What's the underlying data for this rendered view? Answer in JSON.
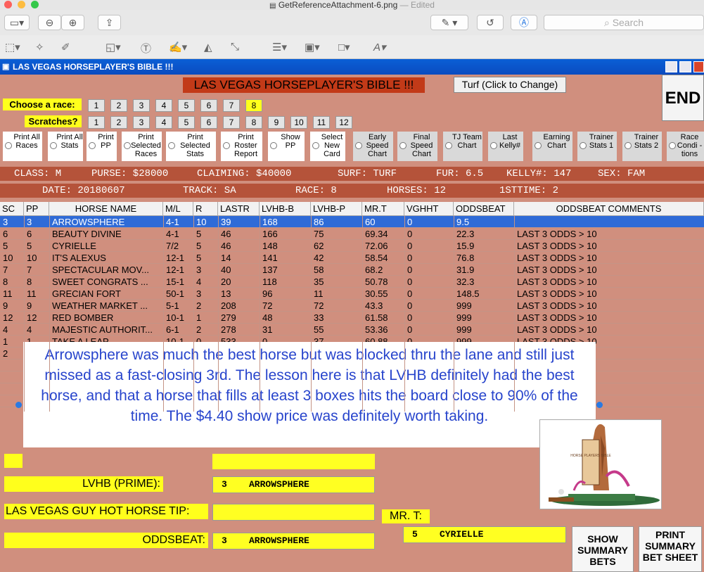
{
  "mac": {
    "title": "GetReferenceAttachment-6.png",
    "edited": "— Edited",
    "search_placeholder": "Search"
  },
  "app": {
    "window_title": "LAS VEGAS HORSEPLAYER'S BIBLE !!!",
    "banner": "LAS VEGAS HORSEPLAYER'S BIBLE !!!",
    "turf_button": "Turf (Click to Change)",
    "end_button": "END"
  },
  "race_select": {
    "choose_label": "Choose  a race:",
    "races": [
      "1",
      "2",
      "3",
      "4",
      "5",
      "6",
      "7",
      "8"
    ],
    "selected_race": "8",
    "scratches_label": "Scratches?",
    "scratches": [
      "1",
      "2",
      "3",
      "4",
      "5",
      "6",
      "7",
      "8",
      "9",
      "10",
      "11",
      "12"
    ]
  },
  "options": [
    {
      "label": "Print All Races"
    },
    {
      "label": "Print All Stats"
    },
    {
      "label": "Print PP"
    },
    {
      "label": "Print Selected Races"
    },
    {
      "label": "Print Selected Stats"
    },
    {
      "label": "Print Roster Report"
    },
    {
      "label": "Show PP"
    },
    {
      "label": "Select New Card"
    },
    {
      "label": "Early Speed Chart"
    },
    {
      "label": "Final Speed Chart"
    },
    {
      "label": "TJ Team Chart"
    },
    {
      "label": "Last Kelly#"
    },
    {
      "label": "Earning Chart"
    },
    {
      "label": "Trainer Stats 1"
    },
    {
      "label": "Trainer Stats 2"
    },
    {
      "label": "Race Condi -tions"
    }
  ],
  "info1": {
    "class": "CLASS: M",
    "purse": "PURSE: $28000",
    "claiming": "CLAIMING: $40000",
    "surf": "SURF: TURF",
    "fur": "FUR: 6.5",
    "kelly": "KELLY#: 147",
    "sex": "SEX: FAM"
  },
  "info2": {
    "date": "DATE: 20180607",
    "track": "TRACK: SA",
    "race": "RACE: 8",
    "horses": "HORSES: 12",
    "firsttime": "1STTIME:  2"
  },
  "table": {
    "columns": [
      "SC",
      "PP",
      "HORSE NAME",
      "M/L",
      "R",
      "LASTR",
      "LVHB-B",
      "LVHB-P",
      "MR.T",
      "VGHHT",
      "ODDSBEAT",
      "ODDSBEAT COMMENTS"
    ],
    "rows": [
      [
        "3",
        "3",
        "ARROWSPHERE",
        "4-1",
        "10",
        "39",
        "168",
        "86",
        "60",
        "0",
        "9.5",
        ""
      ],
      [
        "6",
        "6",
        "BEAUTY DIVINE",
        "4-1",
        "5",
        "46",
        "166",
        "75",
        "69.34",
        "0",
        "22.3",
        "LAST 3 ODDS > 10"
      ],
      [
        "5",
        "5",
        "CYRIELLE",
        "7/2",
        "5",
        "46",
        "148",
        "62",
        "72.06",
        "0",
        "15.9",
        "LAST 3 ODDS > 10"
      ],
      [
        "10",
        "10",
        "IT'S ALEXUS",
        "12-1",
        "5",
        "14",
        "141",
        "42",
        "58.54",
        "0",
        "76.8",
        "LAST 3 ODDS > 10"
      ],
      [
        "7",
        "7",
        "SPECTACULAR MOV...",
        "12-1",
        "3",
        "40",
        "137",
        "58",
        "68.2",
        "0",
        "31.9",
        "LAST 3 ODDS > 10"
      ],
      [
        "8",
        "8",
        "SWEET CONGRATS ...",
        "15-1",
        "4",
        "20",
        "118",
        "35",
        "50.78",
        "0",
        "32.3",
        "LAST 3 ODDS > 10"
      ],
      [
        "11",
        "11",
        "GRECIAN FORT",
        "50-1",
        "3",
        "13",
        "96",
        "11",
        "30.55",
        "0",
        "148.5",
        "LAST 3 ODDS > 10"
      ],
      [
        "9",
        "9",
        "WEATHER MARKET ...",
        "5-1",
        "2",
        "208",
        "72",
        "72",
        "43.3",
        "0",
        "999",
        "LAST 3 ODDS > 10"
      ],
      [
        "12",
        "12",
        "RED BOMBER",
        "10-1",
        "1",
        "279",
        "48",
        "33",
        "61.58",
        "0",
        "999",
        "LAST 3 ODDS > 10"
      ],
      [
        "4",
        "4",
        "MAJESTIC AUTHORIT...",
        "6-1",
        "2",
        "278",
        "31",
        "55",
        "53.36",
        "0",
        "999",
        "LAST 3 ODDS > 10"
      ],
      [
        "1",
        "1",
        "TAKE A LEAP",
        "10-1",
        "0",
        "533",
        "0",
        "37",
        "60.88",
        "0",
        "999",
        "LAST 3 ODDS > 10"
      ],
      [
        "2",
        "",
        "",
        "",
        "",
        "",
        "",
        "",
        "",
        "",
        "",
        "0"
      ]
    ]
  },
  "overlay_text": "Arrowsphere was much the best horse but was blocked thru the lane and still just missed as a fast-closing 3rd.  The lesson here is that LVHB definitely had the best horse, and that a horse that fills at least 3 boxes hits the board close to 90% of the time.  The $4.40 show price was definitely worth taking.",
  "picks": {
    "lvhb_label": "LVHB (PRIME):",
    "lvhb_value": "3    ARROWSPHERE",
    "guy_label": "LAS VEGAS GUY HOT HORSE TIP:",
    "guy_value": "",
    "oddsbeat_label": "ODDSBEAT:",
    "oddsbeat_value": "3    ARROWSPHERE",
    "mrt_label": "MR. T:",
    "mrt_value": "5    CYRIELLE"
  },
  "buttons": {
    "show_summary": "SHOW SUMMARY BETS",
    "print_summary": "PRINT SUMMARY BET SHEET"
  },
  "logo_text": "HORSE PLAYERS BIBLE"
}
